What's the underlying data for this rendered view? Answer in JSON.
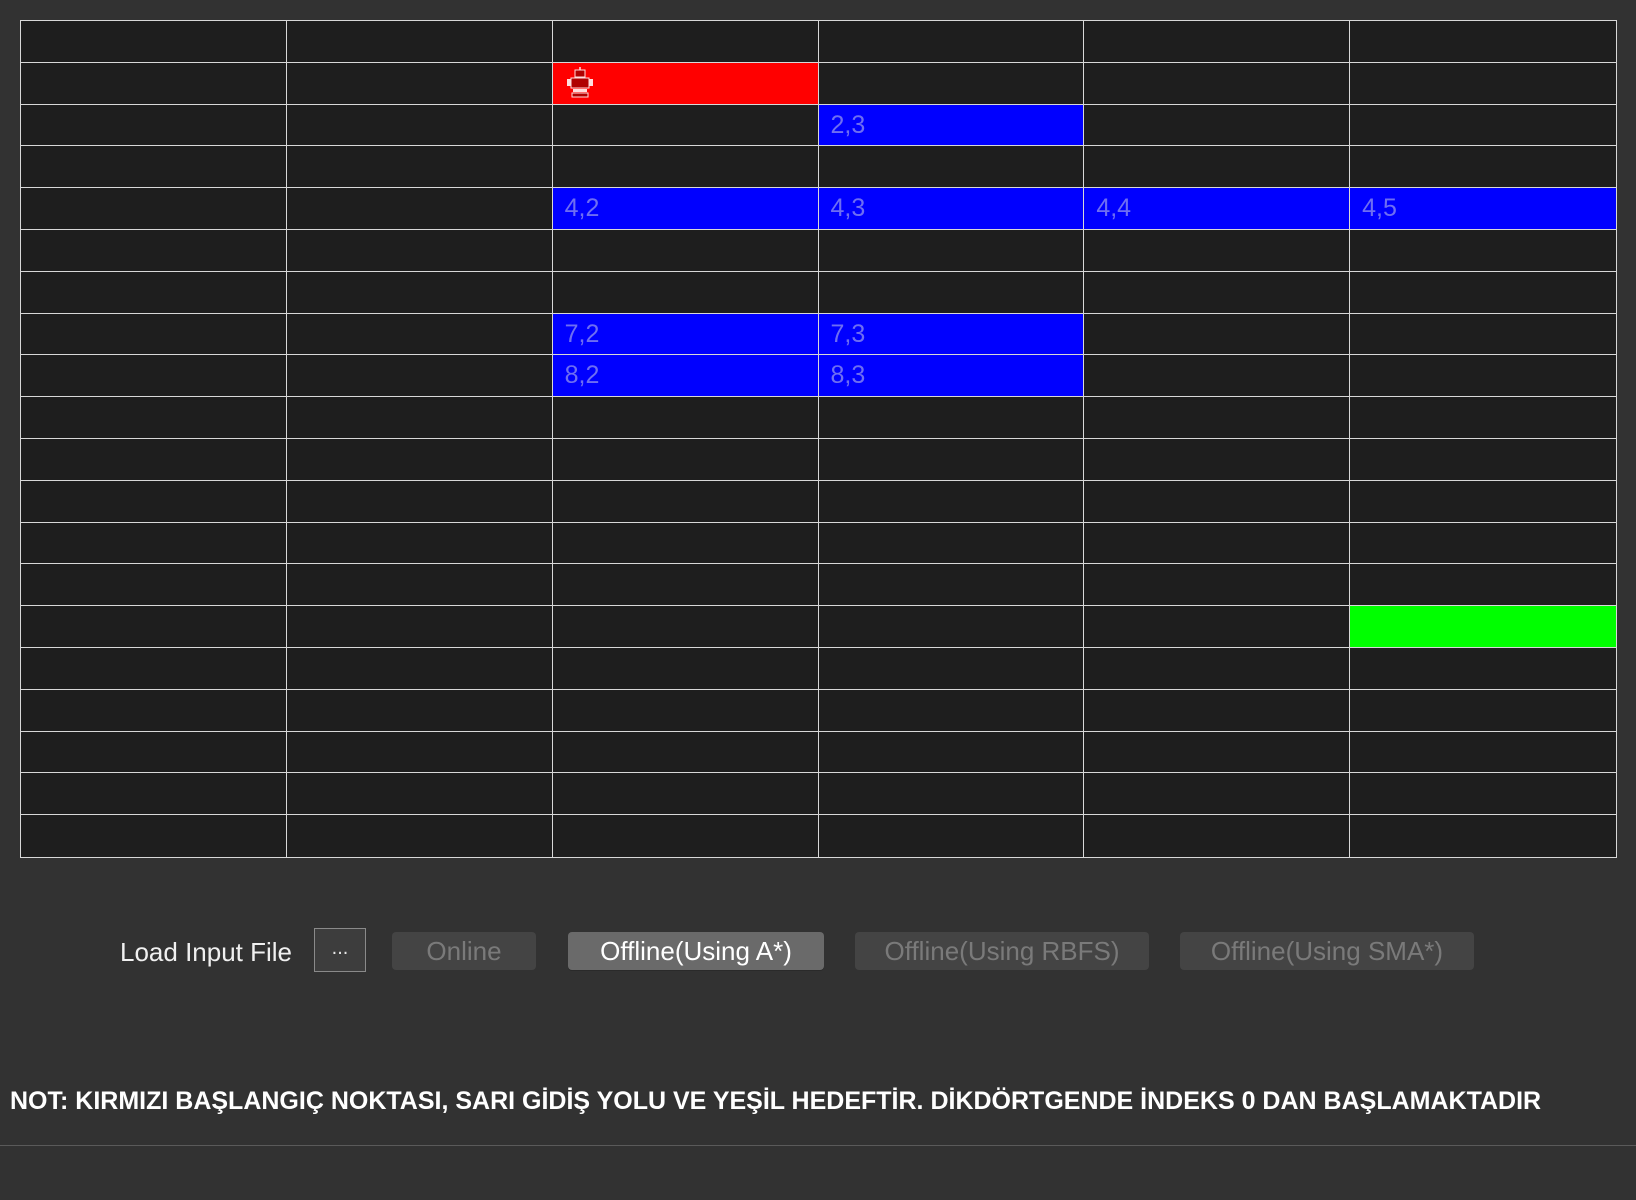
{
  "grid": {
    "rows": 20,
    "cols": 6,
    "colors": {
      "background": "#1e1e1e",
      "line": "#d8d8d8",
      "start": "#ff0000",
      "wall": "#0000ff",
      "goal": "#00ff00",
      "wall_text": "#6e6ef2"
    },
    "start": {
      "row": 1,
      "col": 2,
      "icon": "robot-icon"
    },
    "goal": {
      "row": 14,
      "col": 5
    },
    "walls": [
      {
        "row": 2,
        "col": 3,
        "label": "2,3"
      },
      {
        "row": 4,
        "col": 2,
        "label": "4,2"
      },
      {
        "row": 4,
        "col": 3,
        "label": "4,3"
      },
      {
        "row": 4,
        "col": 4,
        "label": "4,4"
      },
      {
        "row": 4,
        "col": 5,
        "label": "4,5"
      },
      {
        "row": 7,
        "col": 2,
        "label": "7,2"
      },
      {
        "row": 7,
        "col": 3,
        "label": "7,3"
      },
      {
        "row": 8,
        "col": 2,
        "label": "8,2"
      },
      {
        "row": 8,
        "col": 3,
        "label": "8,3"
      }
    ]
  },
  "controls": {
    "load_label": "Load Input File",
    "browse_label": "...",
    "online_label": "Online",
    "offline_astar_label": "Offline(Using A*)",
    "offline_rbfs_label": "Offline(Using RBFS)",
    "offline_sma_label": "Offline(Using SMA*)"
  },
  "note": "NOT: KIRMIZI BAŞLANGIÇ NOKTASI, SARI GİDİŞ YOLU VE YEŞİL HEDEFTİR. DİKDÖRTGENDE İNDEKS 0 DAN BAŞLAMAKTADIR"
}
